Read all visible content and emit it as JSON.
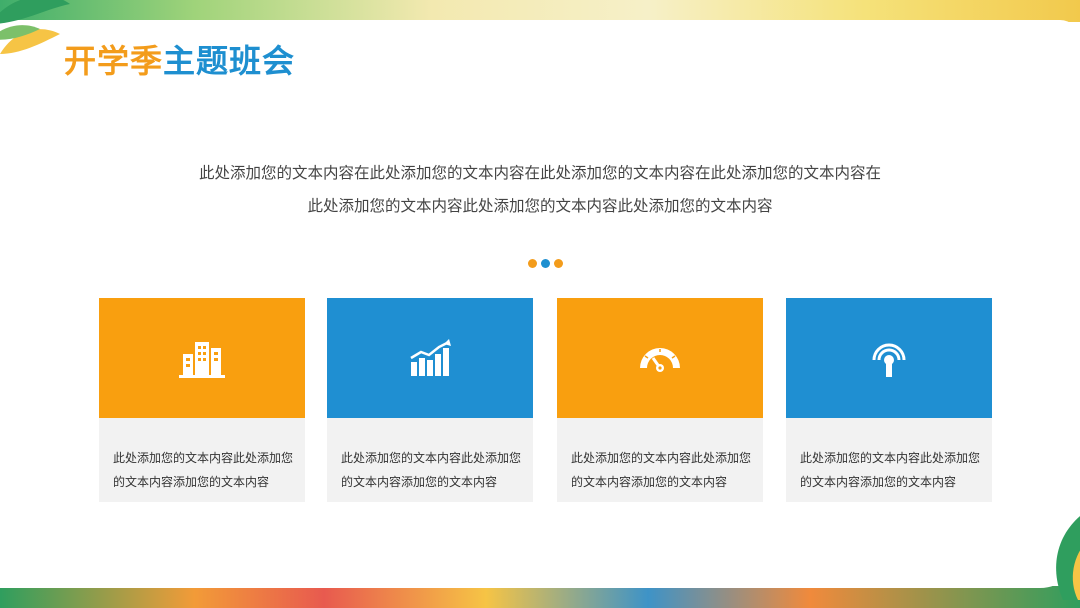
{
  "title": {
    "part1": "开学季",
    "part2": "主题班会"
  },
  "intro": {
    "line1": "此处添加您的文本内容在此处添加您的文本内容在此处添加您的文本内容在此处添加您的文本内容在",
    "line2": "此处添加您的文本内容此处添加您的文本内容此处添加您的文本内容"
  },
  "colors": {
    "orange": "#f99f0f",
    "blue": "#1f8fd2",
    "title_orange": "#f39c1b",
    "title_blue": "#1e8fd0"
  },
  "dots": [
    {
      "color": "#f39c1b"
    },
    {
      "color": "#1e8fd0"
    },
    {
      "color": "#f39c1b"
    }
  ],
  "cards": [
    {
      "icon": "buildings-icon",
      "color": "#f99f0f",
      "text": "此处添加您的文本内容此处添加您的文本内容添加您的文本内容"
    },
    {
      "icon": "growth-chart-icon",
      "color": "#1f8fd2",
      "text": "此处添加您的文本内容此处添加您的文本内容添加您的文本内容"
    },
    {
      "icon": "speedometer-icon",
      "color": "#f99f0f",
      "text": "此处添加您的文本内容此处添加您的文本内容添加您的文本内容"
    },
    {
      "icon": "signal-tower-icon",
      "color": "#1f8fd2",
      "text": "此处添加您的文本内容此处添加您的文本内容添加您的文本内容"
    }
  ]
}
